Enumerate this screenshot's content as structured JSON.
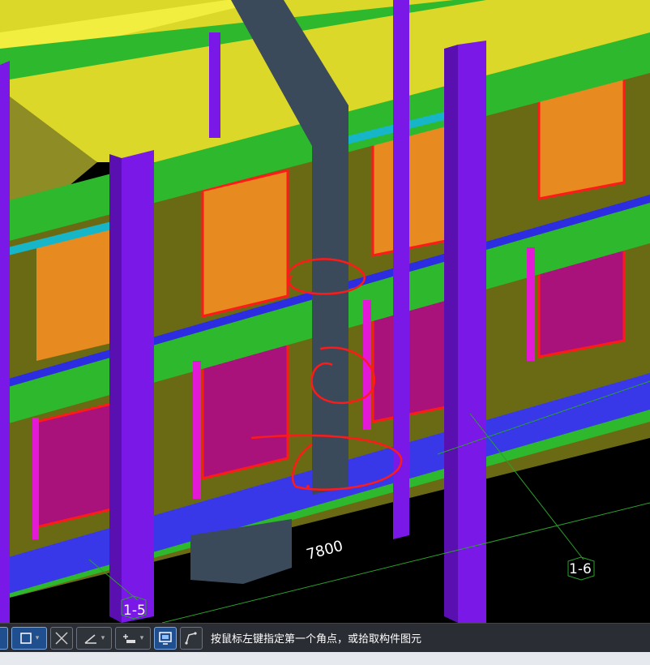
{
  "viewport": {
    "dimension_label": "7800",
    "axis_labels": [
      "1-5",
      "1-6"
    ]
  },
  "toolbar": {
    "buttons": [
      {
        "name": "select-mode-button",
        "icon": "cursor-icon"
      },
      {
        "name": "rectangle-select-button",
        "icon": "rectangle-icon"
      },
      {
        "name": "cross-select-button",
        "icon": "cross-icon"
      },
      {
        "name": "angle-snap-button",
        "icon": "angle-icon"
      },
      {
        "name": "offset-button",
        "icon": "offset-icon"
      },
      {
        "name": "display-button",
        "icon": "monitor-icon"
      },
      {
        "name": "polyline-button",
        "icon": "polyline-icon"
      }
    ],
    "prompt": "按鼠标左键指定第一个角点，或拾取构件图元"
  },
  "colors": {
    "slab": "#dcd82a",
    "beam_green": "#2db82d",
    "column_purple": "#7a18e8",
    "wall_olive": "#6b6a14",
    "magenta": "#e21ad6",
    "blue_beam": "#2c2ce0",
    "annotation_red": "#ff1a1a"
  }
}
